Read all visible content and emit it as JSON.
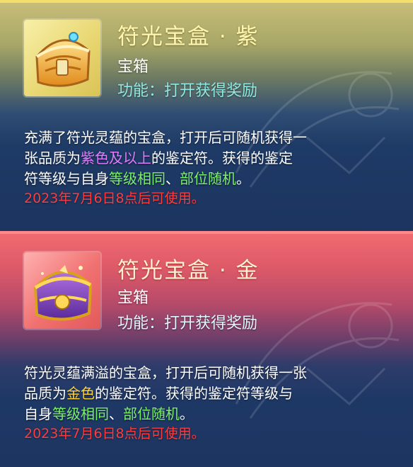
{
  "items": [
    {
      "title": "符光宝盒 · 紫",
      "type": "宝箱",
      "function": "功能：打开获得奖励",
      "desc_line1": "充满了符光灵蕴的宝盒，打开后可随机获得一",
      "desc_line2_a": "张品质为",
      "desc_line2_hl": "紫色及以上",
      "desc_line2_b": "的鉴定符。获得的鉴定",
      "desc_line3_a": "符等级与自身",
      "desc_line3_hl1": "等级相同",
      "desc_line3_sep": "、",
      "desc_line3_hl2": "部位随机",
      "desc_line3_b": "。",
      "date_note": "2023年7月6日8点后可使用。",
      "icon": "purple-treasure-chest-icon"
    },
    {
      "title": "符光宝盒 · 金",
      "type": "宝箱",
      "function": "功能：打开获得奖励",
      "desc_line1": "符光灵蕴满溢的宝盒，打开后可随机获得一张",
      "desc_line2_a": "品质为",
      "desc_line2_hl": "金色",
      "desc_line2_b": "的鉴定符。获得的鉴定符等级与",
      "desc_line3_a": "自身",
      "desc_line3_hl1": "等级相同",
      "desc_line3_sep": "、",
      "desc_line3_hl2": "部位随机",
      "desc_line3_b": "。",
      "date_note": "2023年7月6日8点后可使用。",
      "icon": "gold-treasure-chest-icon"
    }
  ],
  "colors": {
    "highlight_purple": "#e07cff",
    "highlight_gold": "#ffd33a",
    "highlight_green": "#7cf06a",
    "date_red": "#ff3b3b"
  }
}
